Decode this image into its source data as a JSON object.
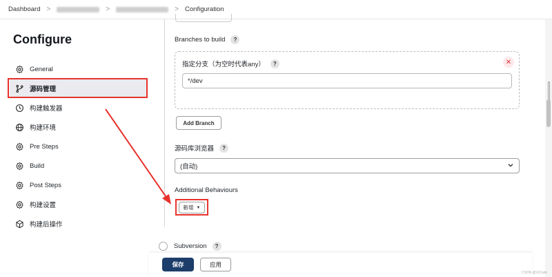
{
  "breadcrumb": {
    "items": [
      "Dashboard",
      "Configuration"
    ],
    "separator": ">"
  },
  "sidebar": {
    "title": "Configure",
    "items": [
      {
        "label": "General",
        "icon": "gear-icon"
      },
      {
        "label": "源码管理",
        "icon": "branch-icon"
      },
      {
        "label": "构建触发器",
        "icon": "clock-icon"
      },
      {
        "label": "构建环境",
        "icon": "globe-icon"
      },
      {
        "label": "Pre Steps",
        "icon": "gear-icon"
      },
      {
        "label": "Build",
        "icon": "gear-icon"
      },
      {
        "label": "Post Steps",
        "icon": "gear-icon"
      },
      {
        "label": "构建设置",
        "icon": "gear-icon"
      },
      {
        "label": "构建后操作",
        "icon": "cube-icon"
      }
    ],
    "active_index": 1
  },
  "main": {
    "branches_label": "Branches to build",
    "branch_specifier_label": "指定分支（为空时代表any）",
    "branch_value": "*/dev",
    "add_branch_label": "Add Branch",
    "repo_browser_label": "源码库浏览器",
    "repo_browser_value": "(自动)",
    "additional_behaviours_label": "Additional Behaviours",
    "add_new_label": "新增",
    "subversion_label": "Subversion",
    "help_symbol": "?"
  },
  "footer": {
    "save_label": "保存",
    "apply_label": "应用"
  },
  "watermark": "CSDN @ViCode",
  "colors": {
    "annotation_red": "#e8322c",
    "primary_button": "#1d3d6b",
    "active_nav_bg": "#eaeaef"
  }
}
